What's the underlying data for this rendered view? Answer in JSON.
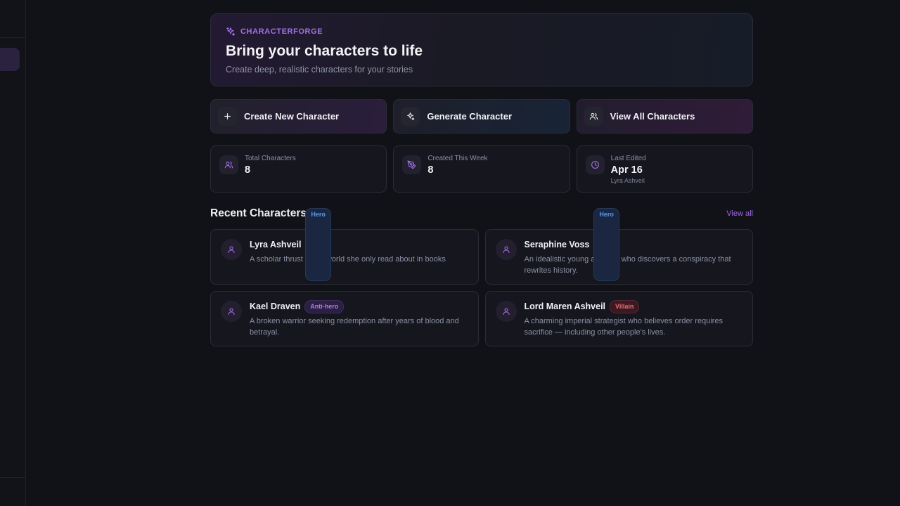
{
  "colors": {
    "accent": "#a072e8",
    "hero_badge": "#5b9af0",
    "antihero_badge": "#b07af0",
    "villain_badge": "#ef6b72"
  },
  "hero": {
    "brand": "CHARACTERFORGE",
    "brand_icon": "sparkles-icon",
    "title": "Bring your characters to life",
    "subtitle": "Create deep, realistic characters for your stories"
  },
  "actions": [
    {
      "label": "Create New Character",
      "icon": "plus-icon"
    },
    {
      "label": "Generate Character",
      "icon": "sparkles-icon"
    },
    {
      "label": "View All Characters",
      "icon": "users-icon"
    }
  ],
  "stats": [
    {
      "label": "Total Characters",
      "value": "8",
      "icon": "users-icon"
    },
    {
      "label": "Created This Week",
      "value": "8",
      "icon": "pen-icon"
    },
    {
      "label": "Last Edited",
      "value": "Apr 16",
      "sub": "Lyra Ashveil",
      "icon": "clock-icon"
    }
  ],
  "recent": {
    "title": "Recent Characters",
    "view_all": "View all",
    "characters": [
      {
        "name": "Lyra Ashveil",
        "role": "Hero",
        "description": "A scholar thrust into a world she only read about in books"
      },
      {
        "name": "Seraphine Voss",
        "role": "Hero",
        "description": "An idealistic young archivist who discovers a conspiracy that rewrites history."
      },
      {
        "name": "Kael Draven",
        "role": "Anti-hero",
        "description": "A broken warrior seeking redemption after years of blood and betrayal."
      },
      {
        "name": "Lord Maren Ashveil",
        "role": "Villain",
        "description": "A charming imperial strategist who believes order requires sacrifice — including other people's lives."
      }
    ]
  }
}
